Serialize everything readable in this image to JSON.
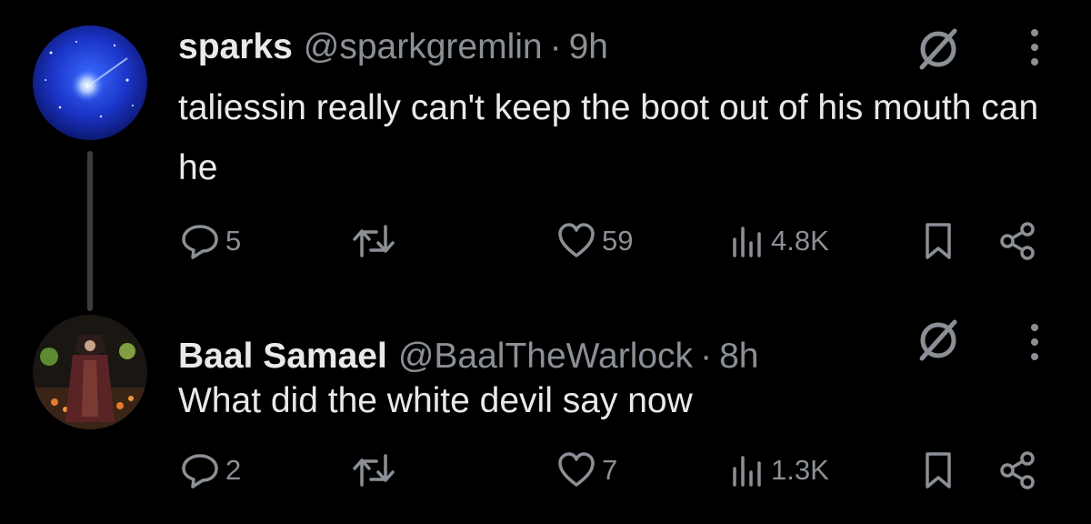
{
  "tweets": [
    {
      "name": "sparks",
      "handle": "@sparkgremlin",
      "separator": "·",
      "time": "9h",
      "text": "taliessin really can't keep the boot out of his mouth can he",
      "replies": "5",
      "likes": "59",
      "views": "4.8K"
    },
    {
      "name": "Baal Samael",
      "handle": "@BaalTheWarlock",
      "separator": "·",
      "time": "8h",
      "text": "What did the white devil say now",
      "replies": "2",
      "likes": "7",
      "views": "1.3K"
    }
  ],
  "icons": {
    "reply": "reply-icon",
    "retweet": "retweet-icon",
    "like": "heart-icon",
    "views": "views-icon",
    "bookmark": "bookmark-icon",
    "share": "share-icon",
    "mute": "mute-icon",
    "more": "more-icon"
  },
  "colors": {
    "background": "#000000",
    "text": "#e7e9ea",
    "secondary": "#8b9096",
    "thread_line": "#3a3e42"
  }
}
